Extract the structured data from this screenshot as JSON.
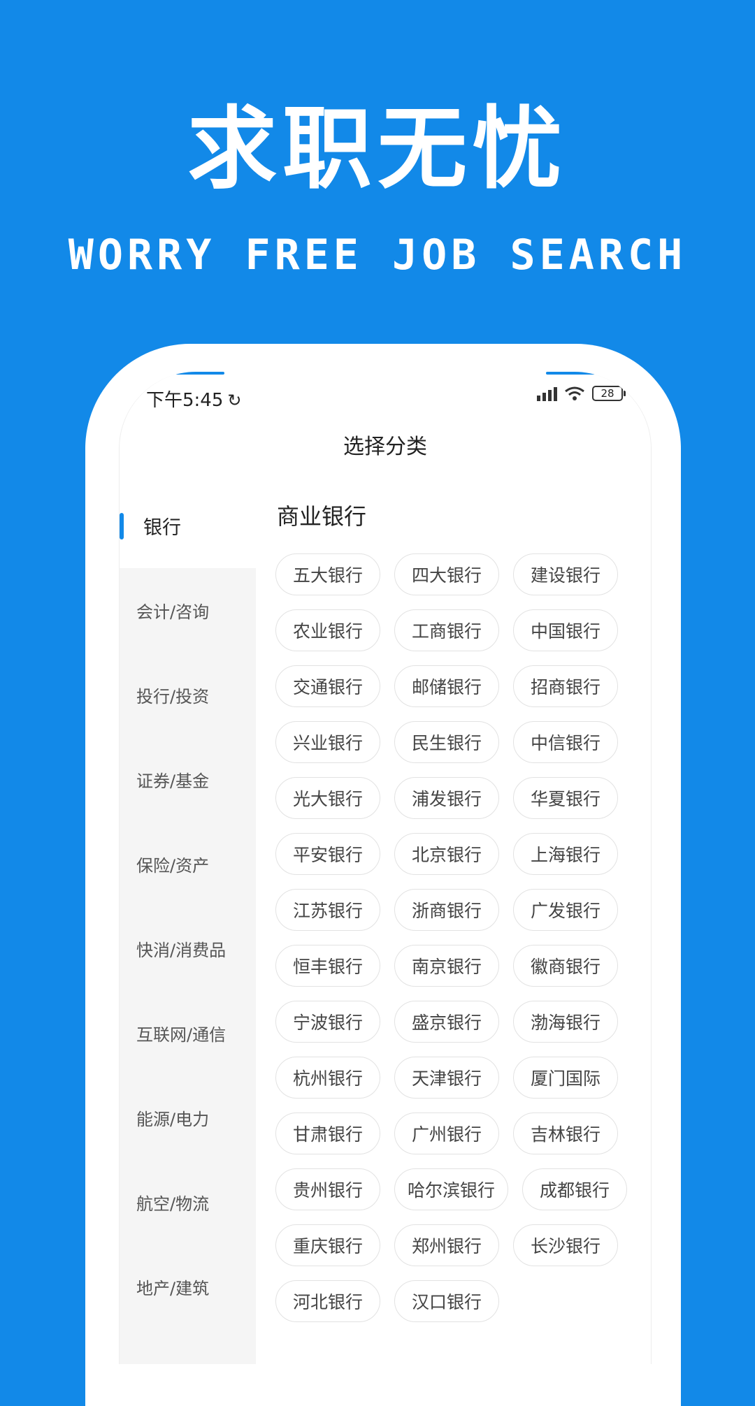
{
  "hero": {
    "title": "求职无忧",
    "subtitle": "WORRY FREE JOB SEARCH"
  },
  "status_bar": {
    "time": "下午5:45",
    "battery": "28"
  },
  "page": {
    "title": "选择分类"
  },
  "sidebar": {
    "items": [
      {
        "label": "银行",
        "active": true
      },
      {
        "label": "会计/咨询"
      },
      {
        "label": "投行/投资"
      },
      {
        "label": "证券/基金"
      },
      {
        "label": "保险/资产"
      },
      {
        "label": "快消/消费品"
      },
      {
        "label": "互联网/通信"
      },
      {
        "label": "能源/电力"
      },
      {
        "label": "航空/物流"
      },
      {
        "label": "地产/建筑"
      }
    ]
  },
  "section": {
    "title": "商业银行",
    "tags": [
      "五大银行",
      "四大银行",
      "建设银行",
      "农业银行",
      "工商银行",
      "中国银行",
      "交通银行",
      "邮储银行",
      "招商银行",
      "兴业银行",
      "民生银行",
      "中信银行",
      "光大银行",
      "浦发银行",
      "华夏银行",
      "平安银行",
      "北京银行",
      "上海银行",
      "江苏银行",
      "浙商银行",
      "广发银行",
      "恒丰银行",
      "南京银行",
      "徽商银行",
      "宁波银行",
      "盛京银行",
      "渤海银行",
      "杭州银行",
      "天津银行",
      "厦门国际",
      "甘肃银行",
      "广州银行",
      "吉林银行",
      "贵州银行",
      "哈尔滨银行",
      "成都银行",
      "重庆银行",
      "郑州银行",
      "长沙银行",
      "河北银行",
      "汉口银行"
    ]
  }
}
